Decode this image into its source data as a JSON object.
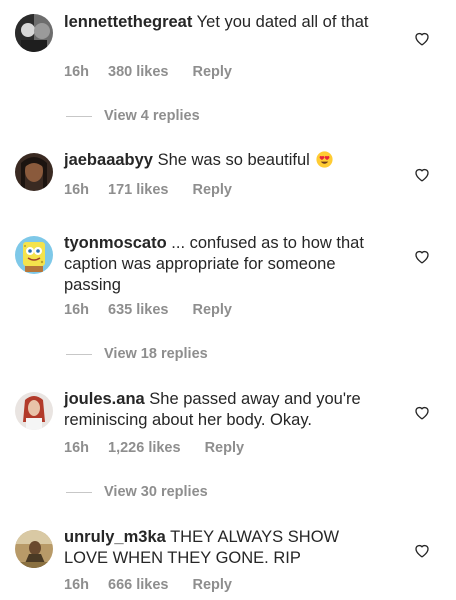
{
  "comments": [
    {
      "username": "lennettethegreat",
      "text": "Yet you dated all of that",
      "time": "16h",
      "likes": "380 likes",
      "reply": "Reply",
      "view_replies": "View 4 replies",
      "avatar": "avatar-photo-bw-portrait"
    },
    {
      "username": "jaebaaabyy",
      "text": "She was so beautiful",
      "emoji": "heart-eyes-emoji",
      "time": "16h",
      "likes": "171 likes",
      "reply": "Reply",
      "avatar": "avatar-photo-woman"
    },
    {
      "username": "tyonmoscato",
      "text": "... confused as to how that caption was appropriate for someone passing",
      "time": "16h",
      "likes": "635 likes",
      "reply": "Reply",
      "view_replies": "View 18 replies",
      "avatar": "avatar-spongebob"
    },
    {
      "username": "joules.ana",
      "text": "She passed away and you're reminiscing about her body. Okay.",
      "time": "16h",
      "likes": "1,226 likes",
      "reply": "Reply",
      "view_replies": "View 30 replies",
      "avatar": "avatar-photo-redhead"
    },
    {
      "username": "unruly_m3ka",
      "text": "THEY ALWAYS SHOW LOVE WHEN THEY GONE.  RIP",
      "time": "16h",
      "likes": "666 likes",
      "reply": "Reply",
      "avatar": "avatar-photo-outdoor"
    }
  ],
  "colors": {
    "text": "#262626",
    "meta": "#8e8e8e",
    "divider": "#c7c7c7"
  },
  "icons": {
    "like": "heart-outline-icon"
  }
}
